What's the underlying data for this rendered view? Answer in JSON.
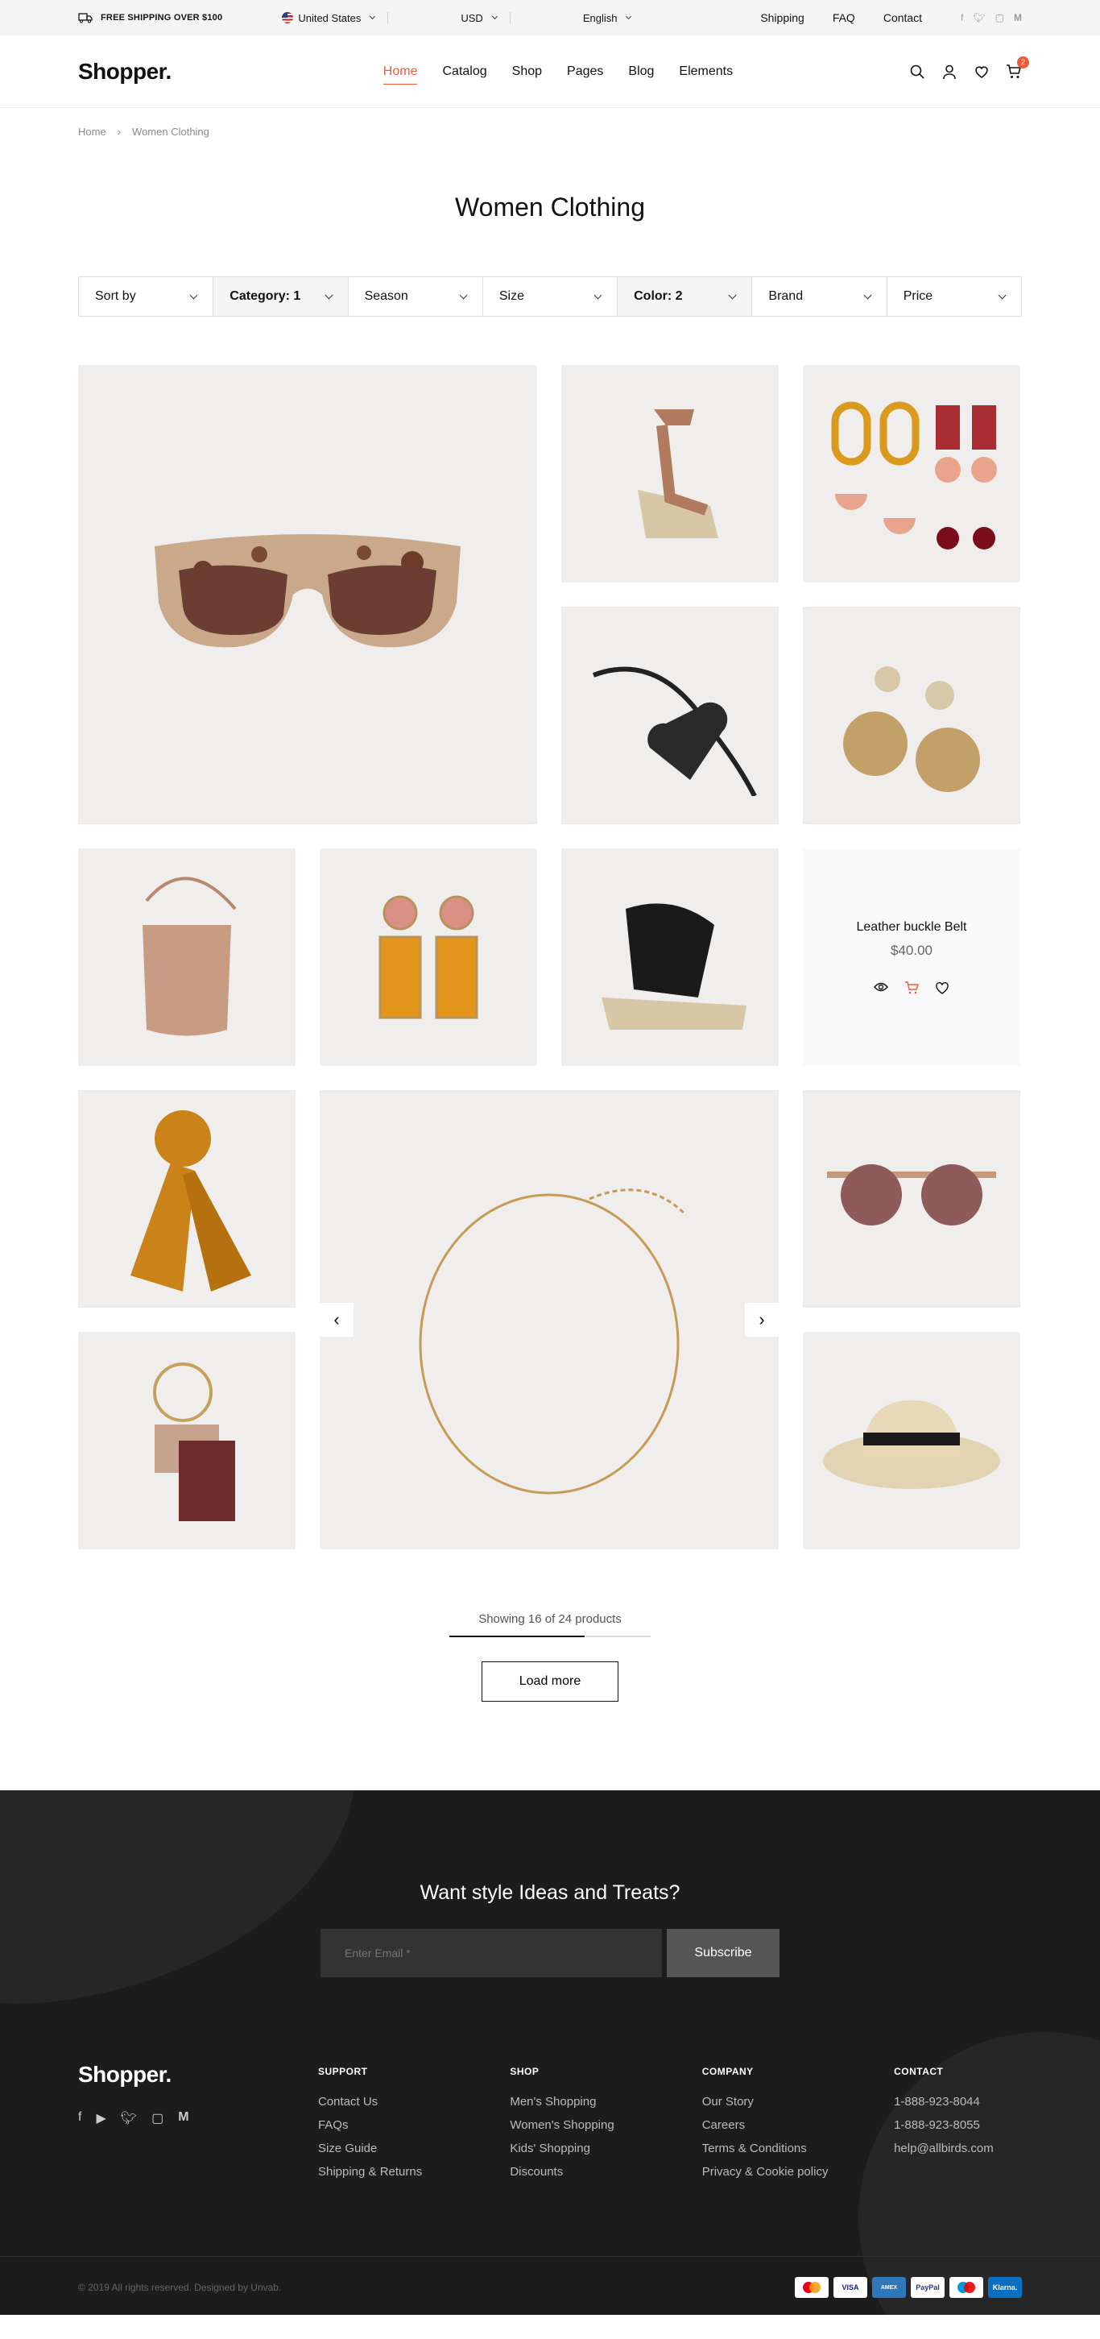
{
  "topbar": {
    "shipping": "FREE SHIPPING OVER $100",
    "country": "United States",
    "currency": "USD",
    "language": "English",
    "links": [
      "Shipping",
      "FAQ",
      "Contact"
    ],
    "social": [
      "f",
      "t",
      "ig",
      "M"
    ]
  },
  "header": {
    "logo": "Shopper.",
    "nav": [
      "Home",
      "Catalog",
      "Shop",
      "Pages",
      "Blog",
      "Elements"
    ],
    "active_nav": "Home",
    "cart_count": "2"
  },
  "breadcrumb": [
    "Home",
    "Women Clothing"
  ],
  "page_title": "Women Clothing",
  "filters": [
    {
      "label": "Sort by"
    },
    {
      "label": "Category: 1"
    },
    {
      "label": "Season"
    },
    {
      "label": "Size"
    },
    {
      "label": "Color: 2"
    },
    {
      "label": "Brand"
    },
    {
      "label": "Price"
    }
  ],
  "products": {
    "hover_card": {
      "name": "Leather buckle Belt",
      "price": "$40.00"
    }
  },
  "pagination": {
    "showing": "Showing 16 of 24 products",
    "progress": 0.67,
    "load_more": "Load more"
  },
  "footer": {
    "newsletter_title": "Want style Ideas and Treats?",
    "email_placeholder": "Enter Email *",
    "subscribe": "Subscribe",
    "logo": "Shopper.",
    "columns": [
      {
        "title": "SUPPORT",
        "items": [
          "Contact Us",
          "FAQs",
          "Size Guide",
          "Shipping & Returns"
        ]
      },
      {
        "title": "SHOP",
        "items": [
          "Men's Shopping",
          "Women's Shopping",
          "Kids' Shopping",
          "Discounts"
        ]
      },
      {
        "title": "COMPANY",
        "items": [
          "Our Story",
          "Careers",
          "Terms & Conditions",
          "Privacy & Cookie policy"
        ]
      },
      {
        "title": "CONTACT",
        "items": [
          "1-888-923-8044",
          "1-888-923-8055",
          "help@allbirds.com"
        ]
      }
    ],
    "copyright": "© 2019 All rights reserved. Designed by Unvab.",
    "payments": [
      "MasterCard",
      "VISA",
      "AMEX",
      "PayPal",
      "Maestro",
      "Klarna."
    ]
  },
  "colors": {
    "accent": "#f0593e",
    "footer_bg": "#1c1c1c"
  }
}
